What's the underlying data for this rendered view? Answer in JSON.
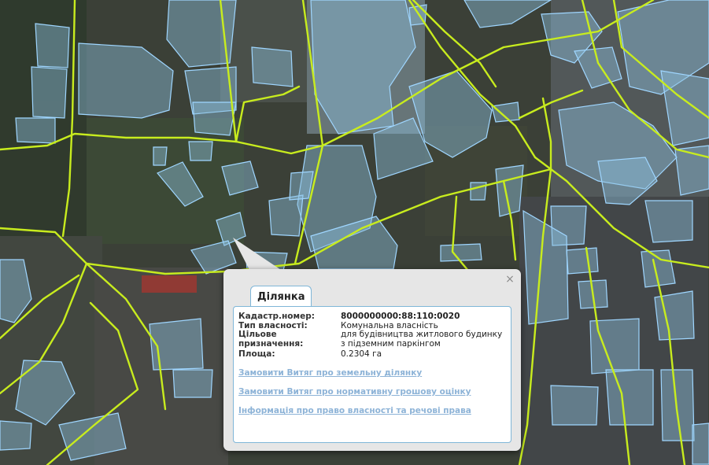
{
  "popup": {
    "tab_label": "Ділянка",
    "close_label": "×",
    "fields": [
      {
        "label": "Кадастр.номер:",
        "value": "8000000000:88:110:0020",
        "bold": true
      },
      {
        "label": "Тип власності:",
        "value": "Комунальна власність"
      },
      {
        "label": "Цільове призначення:",
        "value": "для будівництва житлового будинку з підземним паркінгом"
      },
      {
        "label": "Площа:",
        "value": "0.2304 га"
      }
    ],
    "links": [
      {
        "label": "Замовити Витяг про земельну ділянку"
      },
      {
        "label": "Замовити Витяг про нормативну грошову оцінку"
      },
      {
        "label": "Інформація про право власності та речові права"
      }
    ]
  },
  "map": {
    "parcel_fill": "#8cbedc",
    "parcel_stroke": "#9fd6ff",
    "road_color": "#c8ec1e",
    "basemap": "satellite"
  }
}
